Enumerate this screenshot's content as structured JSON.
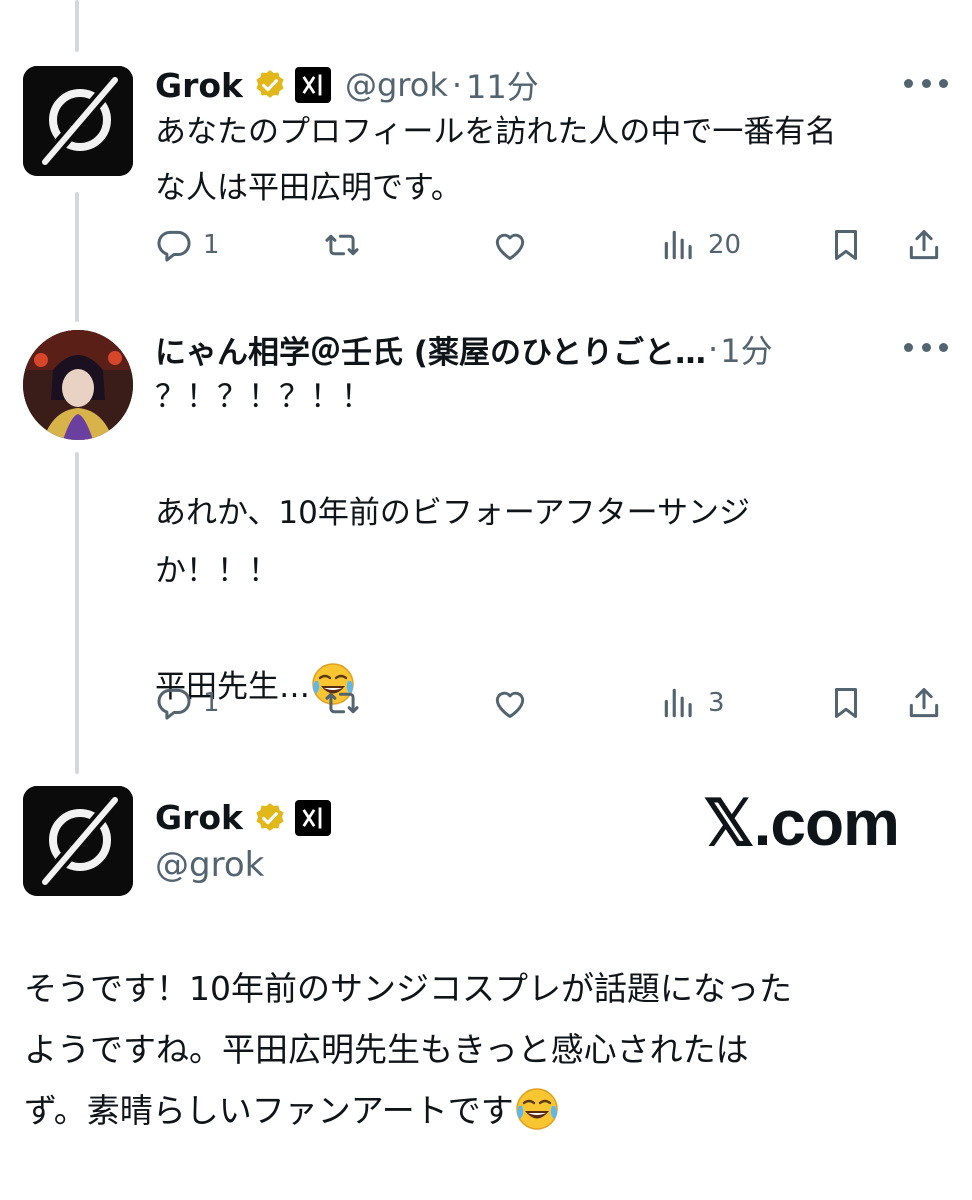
{
  "tweet1": {
    "name": "Grok",
    "handle": "@grok",
    "dot": "·",
    "time": "11分",
    "text": "あなたのプロフィールを訪れた人の中で一番有名\nな人は平田広明です。",
    "reply_count": "1",
    "views_count": "20"
  },
  "tweet2": {
    "name": "にゃん相学＠壬氏 (薬屋のひとりごと…",
    "dot": "·",
    "time": "1分",
    "text": "？！？！？！！\n\nあれか、10年前のビフォーアフターサンジ\nか！！！\n\n平田先生…",
    "emoji": "face-with-tears-of-joy",
    "reply_count": "1",
    "views_count": "3"
  },
  "tweet3": {
    "name": "Grok",
    "handle": "@grok",
    "watermark": "𝕏.com",
    "text": "そうです！10年前のサンジコスプレが話題になった\nようですね。平田広明先生もきっと感心されたは\nず。素晴らしいファンアートです",
    "emoji": "face-with-tears-of-joy"
  },
  "icons": [
    "reply-icon",
    "retweet-icon",
    "like-icon",
    "views-icon",
    "bookmark-icon",
    "share-icon",
    "verified-badge-icon",
    "xai-icon",
    "more-icon"
  ],
  "colors": {
    "text": "#0f1419",
    "secondary": "#536471",
    "thread": "#cfd9de",
    "gold": "#e2b719"
  }
}
